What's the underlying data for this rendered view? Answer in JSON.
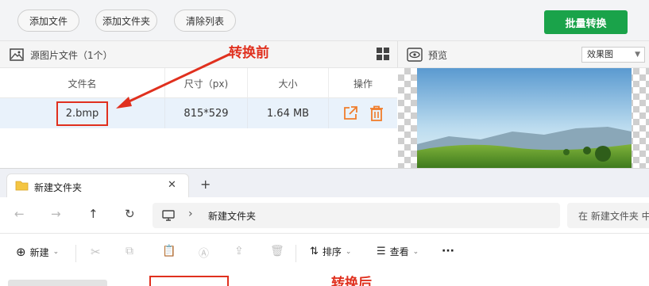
{
  "toolbar": {
    "add_file": "添加文件",
    "add_folder": "添加文件夹",
    "clear_list": "清除列表",
    "batch_convert": "批量转换"
  },
  "source_panel": {
    "title": "源图片文件（1个）",
    "columns": [
      "文件名",
      "尺寸（px)",
      "大小",
      "操作"
    ],
    "rows": [
      {
        "filename": "2.bmp",
        "dimensions": "815*529",
        "size": "1.64 MB"
      }
    ]
  },
  "preview_panel": {
    "title": "预览",
    "mode_select": "效果图"
  },
  "annotations": {
    "before": "转换前",
    "after": "转换后"
  },
  "explorer": {
    "tab_title": "新建文件夹",
    "address": "新建文件夹",
    "search_placeholder": "在 新建文件夹 中搜索",
    "commands": {
      "new": "新建",
      "sort": "排序",
      "view": "查看"
    }
  },
  "colors": {
    "accent_green": "#1aa34a",
    "annotation_red": "#e0301e",
    "action_orange": "#f07d2c"
  }
}
